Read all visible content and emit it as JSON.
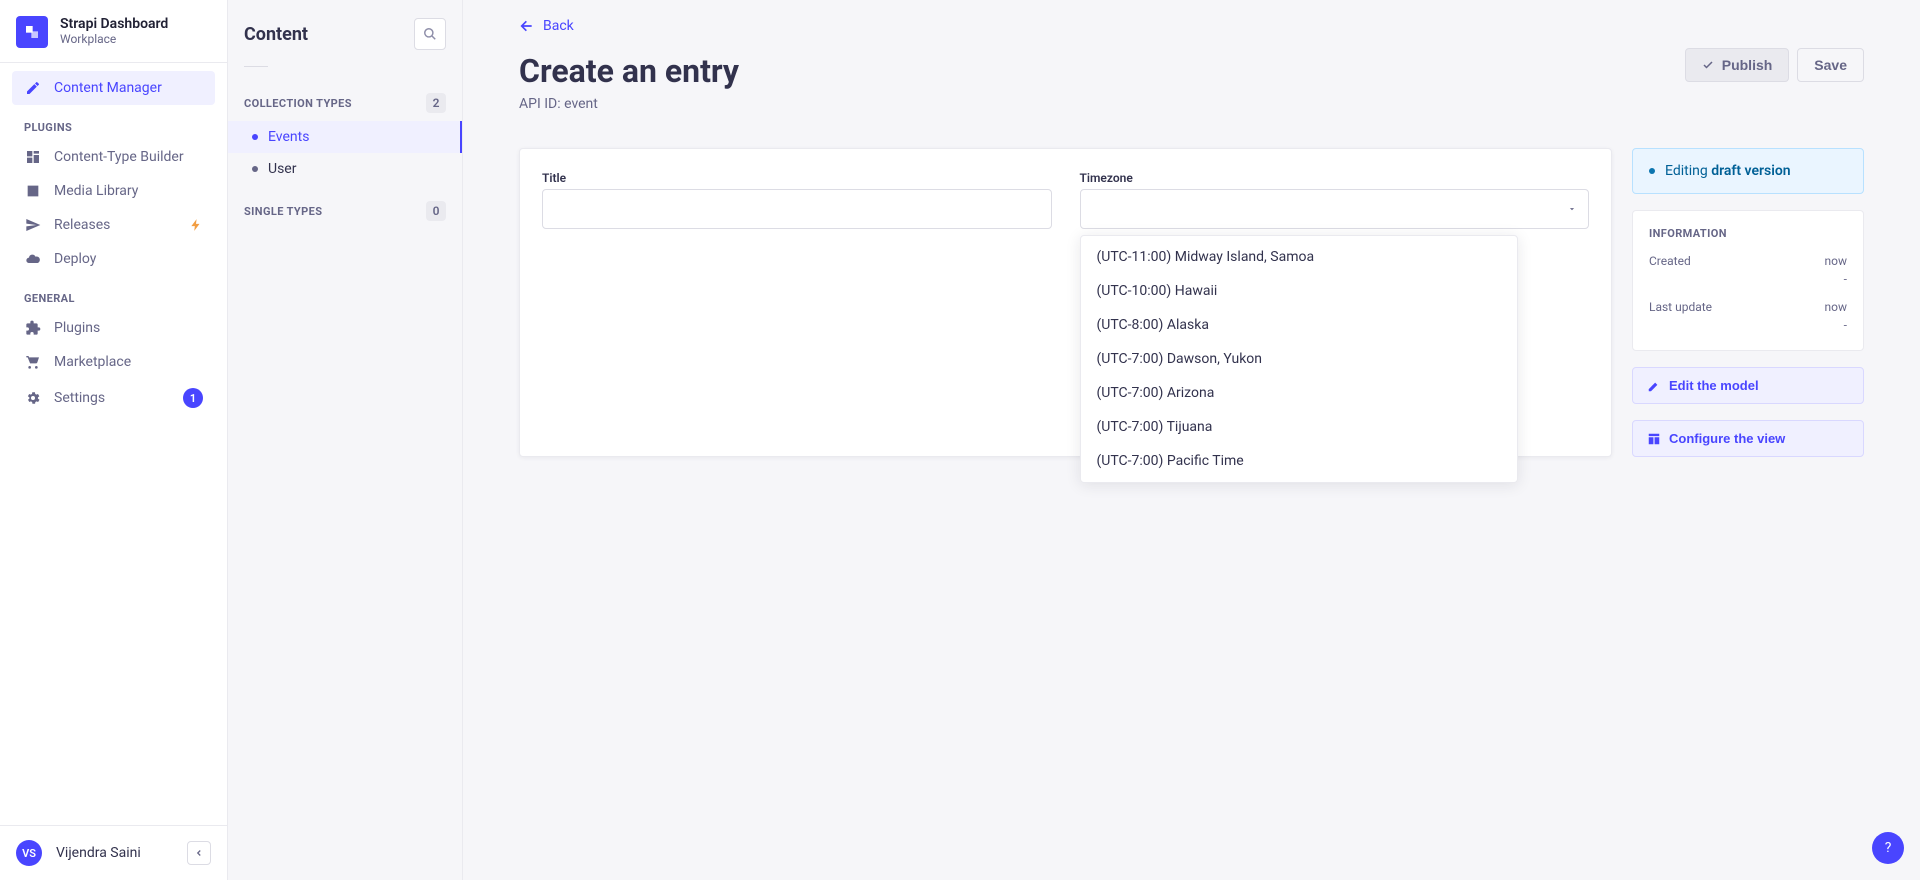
{
  "brand": {
    "title": "Strapi Dashboard",
    "subtitle": "Workplace"
  },
  "nav": {
    "content_manager": "Content Manager",
    "plugins_section": "PLUGINS",
    "content_type_builder": "Content-Type Builder",
    "media_library": "Media Library",
    "releases": "Releases",
    "deploy": "Deploy",
    "general_section": "GENERAL",
    "plugins": "Plugins",
    "marketplace": "Marketplace",
    "settings": "Settings",
    "settings_badge": "1"
  },
  "user": {
    "initials": "VS",
    "name": "Vijendra Saini"
  },
  "content_panel": {
    "title": "Content",
    "collection_label": "COLLECTION TYPES",
    "collection_count": "2",
    "items": [
      {
        "label": "Events"
      },
      {
        "label": "User"
      }
    ],
    "single_label": "SINGLE TYPES",
    "single_count": "0"
  },
  "page": {
    "back": "Back",
    "title": "Create an entry",
    "api_id": "API ID: event",
    "publish": "Publish",
    "save": "Save"
  },
  "form": {
    "title_label": "Title",
    "title_value": "",
    "timezone_label": "Timezone",
    "timezone_value": "",
    "timezone_options": [
      "(UTC-11:00) Midway Island, Samoa",
      "(UTC-10:00) Hawaii",
      "(UTC-8:00) Alaska",
      "(UTC-7:00) Dawson, Yukon",
      "(UTC-7:00) Arizona",
      "(UTC-7:00) Tijuana",
      "(UTC-7:00) Pacific Time"
    ]
  },
  "status": {
    "editing_prefix": "Editing ",
    "draft": "draft version"
  },
  "info": {
    "title": "INFORMATION",
    "created_label": "Created",
    "created_value": "now",
    "created_by": "-",
    "updated_label": "Last update",
    "updated_value": "now",
    "updated_by": "-"
  },
  "actions": {
    "edit_model": "Edit the model",
    "configure_view": "Configure the view"
  },
  "help": "?"
}
